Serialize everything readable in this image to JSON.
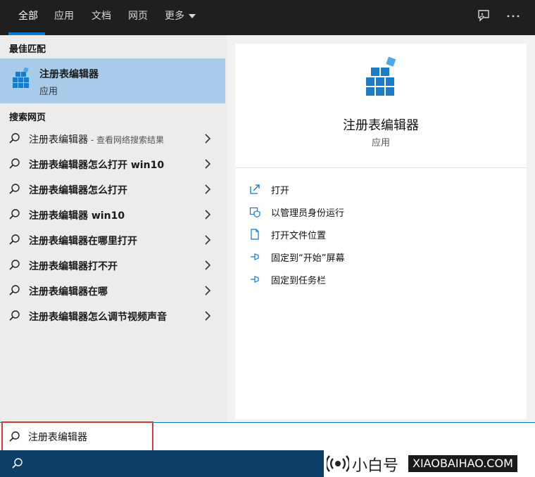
{
  "tabs": [
    {
      "label": "全部",
      "active": true
    },
    {
      "label": "应用"
    },
    {
      "label": "文档"
    },
    {
      "label": "网页"
    },
    {
      "label": "更多"
    }
  ],
  "topbar_icons": [
    "feedback-icon",
    "more-options-icon"
  ],
  "best_match": {
    "section_label": "最佳匹配",
    "name": "注册表编辑器",
    "type": "应用"
  },
  "web_search": {
    "section_label": "搜索网页",
    "items": [
      {
        "query": "注册表编辑器",
        "hint": " - 查看网络搜索结果"
      },
      {
        "query": "注册表编辑器怎么打开 win10",
        "hint": ""
      },
      {
        "query": "注册表编辑器怎么打开",
        "hint": ""
      },
      {
        "query": "注册表编辑器 win10",
        "hint": ""
      },
      {
        "query": "注册表编辑器在哪里打开",
        "hint": ""
      },
      {
        "query": "注册表编辑器打不开",
        "hint": ""
      },
      {
        "query": "注册表编辑器在哪",
        "hint": ""
      },
      {
        "query": "注册表编辑器怎么调节视频声音",
        "hint": ""
      }
    ]
  },
  "detail": {
    "title": "注册表编辑器",
    "subtitle": "应用",
    "actions": [
      {
        "label": "打开",
        "icon": "open-icon"
      },
      {
        "label": "以管理员身份运行",
        "icon": "run-as-admin-icon"
      },
      {
        "label": "打开文件位置",
        "icon": "file-location-icon"
      },
      {
        "label": "固定到“开始”屏幕",
        "icon": "pin-start-icon"
      },
      {
        "label": "固定到任务栏",
        "icon": "pin-taskbar-icon"
      }
    ]
  },
  "search": {
    "value": "注册表编辑器"
  },
  "watermark": {
    "cn": "小白号",
    "en": "XIAOBAIHAO.COM"
  },
  "colors": {
    "accent": "#0a78d4",
    "selection": "#a9cbea",
    "topbar": "#1f1f1f",
    "taskbar": "#0d3f66",
    "highlight_frame": "#d33a3a"
  }
}
